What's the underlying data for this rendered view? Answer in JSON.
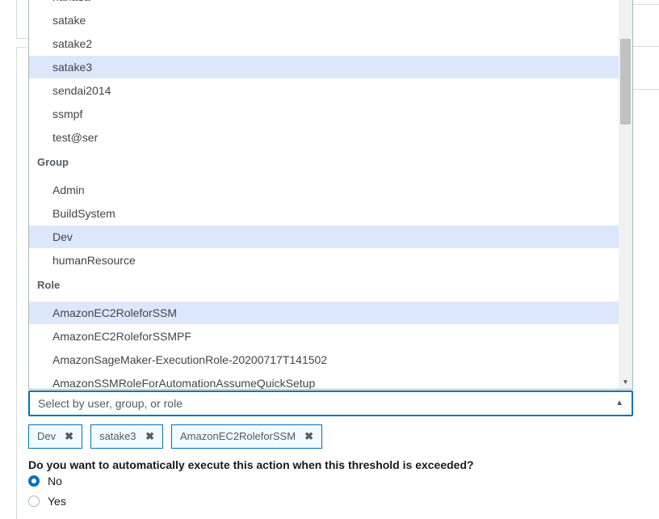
{
  "dropdown": {
    "partial_top_item": "hanada",
    "users": [
      "satake",
      "satake2",
      "satake3",
      "sendai2014",
      "ssmpf",
      "test@ser"
    ],
    "group_header": "Group",
    "groups": [
      "Admin",
      "BuildSystem",
      "Dev",
      "humanResource"
    ],
    "role_header": "Role",
    "roles": [
      "AmazonEC2RoleforSSM",
      "AmazonEC2RoleforSSMPF",
      "AmazonSageMaker-ExecutionRole-20200717T141502",
      "AmazonSSMRoleForAutomationAssumeQuickSetup"
    ],
    "scroll_up_icon": "triangle-up-icon",
    "scroll_down_icon": "triangle-down-icon"
  },
  "select": {
    "placeholder": "Select by user, group, or role",
    "caret_icon": "caret-up-icon"
  },
  "tokens": [
    {
      "label": "Dev",
      "remove": "✖"
    },
    {
      "label": "satake3",
      "remove": "✖"
    },
    {
      "label": "AmazonEC2RoleforSSM",
      "remove": "✖"
    }
  ],
  "question": "Do you want to automatically execute this action when this threshold is exceeded?",
  "options": [
    {
      "label": "No",
      "selected": true
    },
    {
      "label": "Yes",
      "selected": false
    }
  ],
  "colors": {
    "accent": "#0073bb",
    "highlight": "#dde7fb"
  }
}
